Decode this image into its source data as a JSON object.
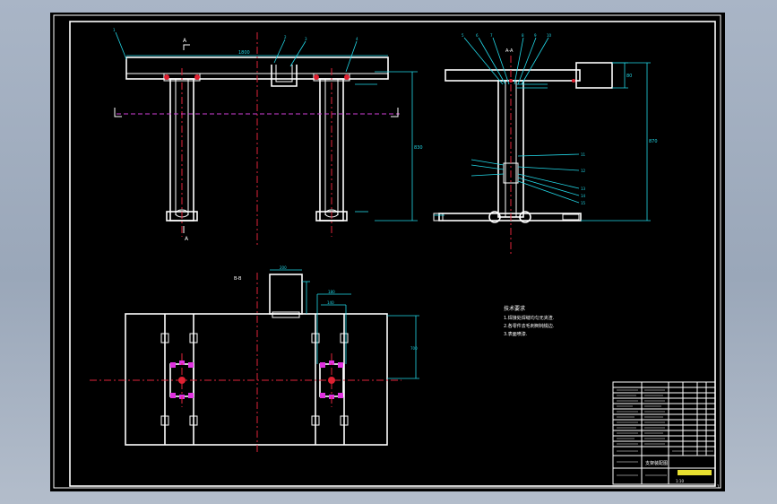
{
  "drawing": {
    "background": "#000000",
    "frame_color": "#ffffff",
    "centerline_color": "#e0243a",
    "dimension_color": "#22d8e8",
    "section_color": "#d040d8"
  },
  "front_view": {
    "section_label_top": "A",
    "section_label_bottom": "A",
    "dim_beam_length": "1800",
    "dim_height": "830",
    "leaders": [
      "1",
      "2",
      "3",
      "4"
    ]
  },
  "side_view": {
    "view_label": "A-A",
    "dim_height": "870",
    "dim_box": "80",
    "leaders": [
      "5",
      "6",
      "7",
      "8",
      "9",
      "10"
    ],
    "mid_callouts": [
      "11",
      "12",
      "13",
      "14",
      "15"
    ]
  },
  "plan_view": {
    "view_label": "B-B",
    "dim_box_width": "200",
    "dim_inner_a": "180",
    "dim_inner_b": "140",
    "dim_depth": "700"
  },
  "notes": {
    "heading": "技术要求",
    "lines": [
      "1.焊接处焊缝均匀无夹渣.",
      "2.各零件去毛刺倒钝锐边.",
      "3.表面喷漆."
    ]
  },
  "title_block": {
    "drawing_name": "支架装配图",
    "scale": "1:10",
    "sheet": "1"
  }
}
